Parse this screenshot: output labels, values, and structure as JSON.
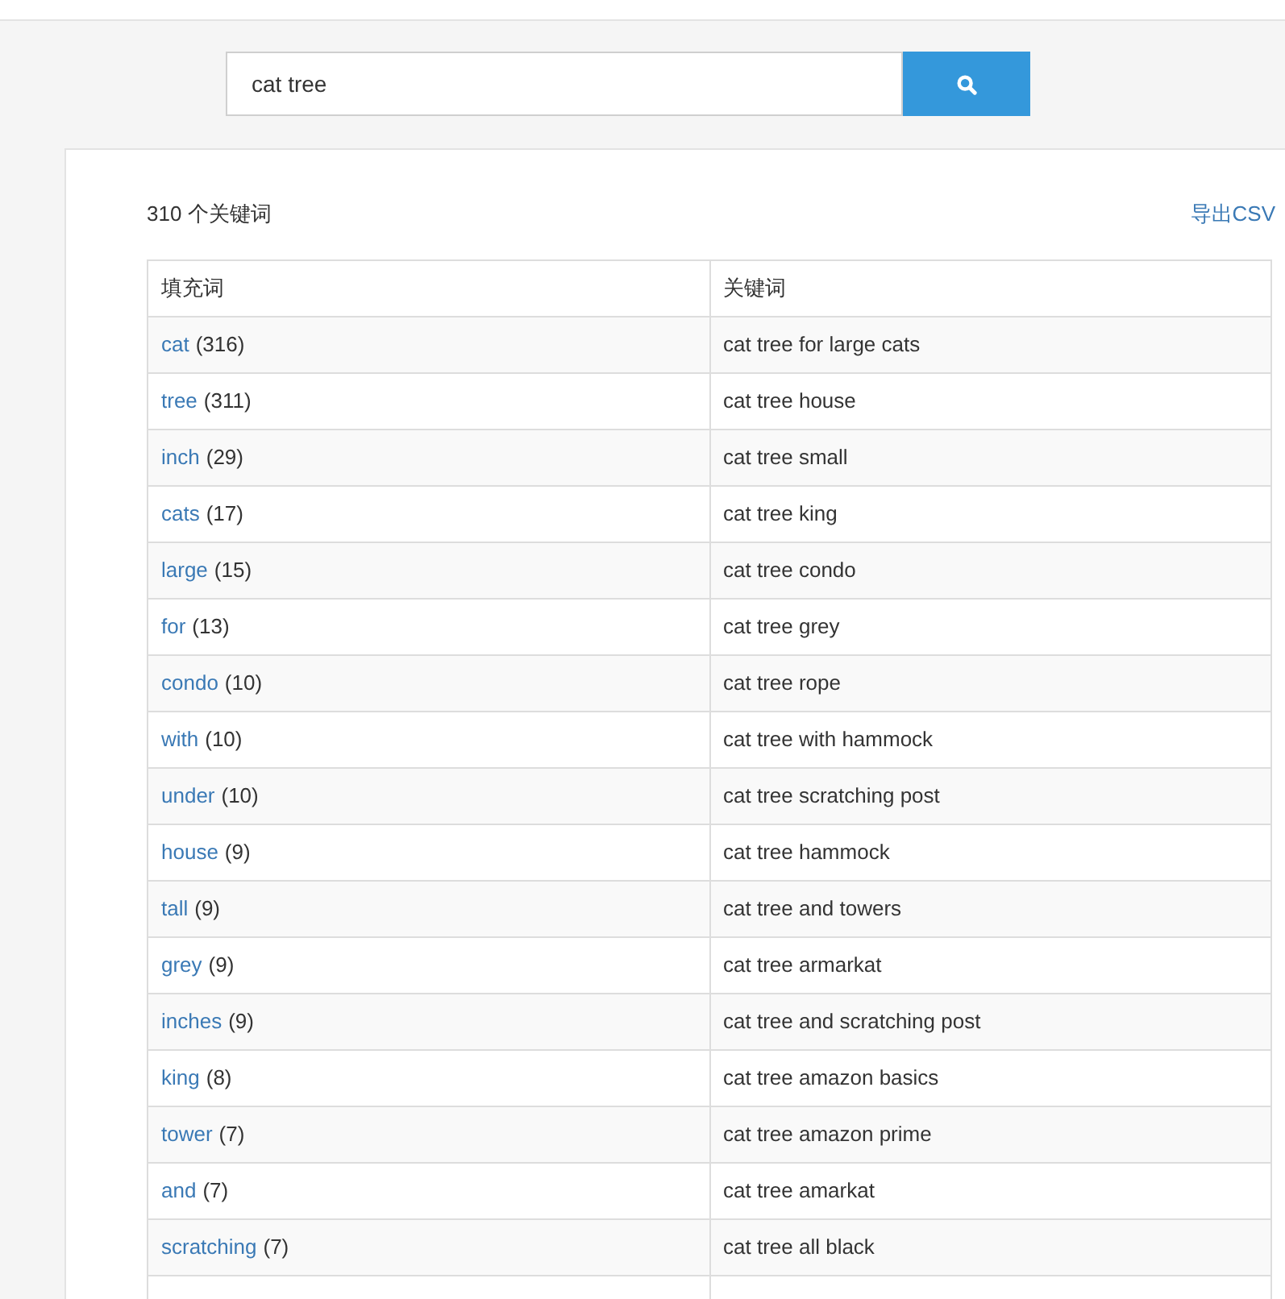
{
  "search": {
    "value": "cat tree"
  },
  "results": {
    "count": "310 个关键词",
    "export_link": "导出CSV"
  },
  "fillers": {
    "heading": "填充词",
    "rows": [
      {
        "word": "cat",
        "count": "(316)"
      },
      {
        "word": "tree",
        "count": "(311)"
      },
      {
        "word": "inch",
        "count": "(29)"
      },
      {
        "word": "cats",
        "count": "(17)"
      },
      {
        "word": "large",
        "count": "(15)"
      },
      {
        "word": "for",
        "count": "(13)"
      },
      {
        "word": "condo",
        "count": "(10)"
      },
      {
        "word": "with",
        "count": "(10)"
      },
      {
        "word": "under",
        "count": "(10)"
      },
      {
        "word": "house",
        "count": "(9)"
      },
      {
        "word": "tall",
        "count": "(9)"
      },
      {
        "word": "grey",
        "count": "(9)"
      },
      {
        "word": "inches",
        "count": "(9)"
      },
      {
        "word": "king",
        "count": "(8)"
      },
      {
        "word": "tower",
        "count": "(7)"
      },
      {
        "word": "and",
        "count": "(7)"
      },
      {
        "word": "scratching",
        "count": "(7)"
      }
    ]
  },
  "keywords": {
    "heading": "关键词",
    "rows": [
      "cat tree for large cats",
      "cat tree house",
      "cat tree small",
      "cat tree king",
      "cat tree condo",
      "cat tree grey",
      "cat tree rope",
      "cat tree with hammock",
      "cat tree scratching post",
      "cat tree hammock",
      "cat tree and towers",
      "cat tree armarkat",
      "cat tree and scratching post",
      "cat tree amazon basics",
      "cat tree amazon prime",
      "cat tree amarkat",
      "cat tree all black"
    ]
  }
}
